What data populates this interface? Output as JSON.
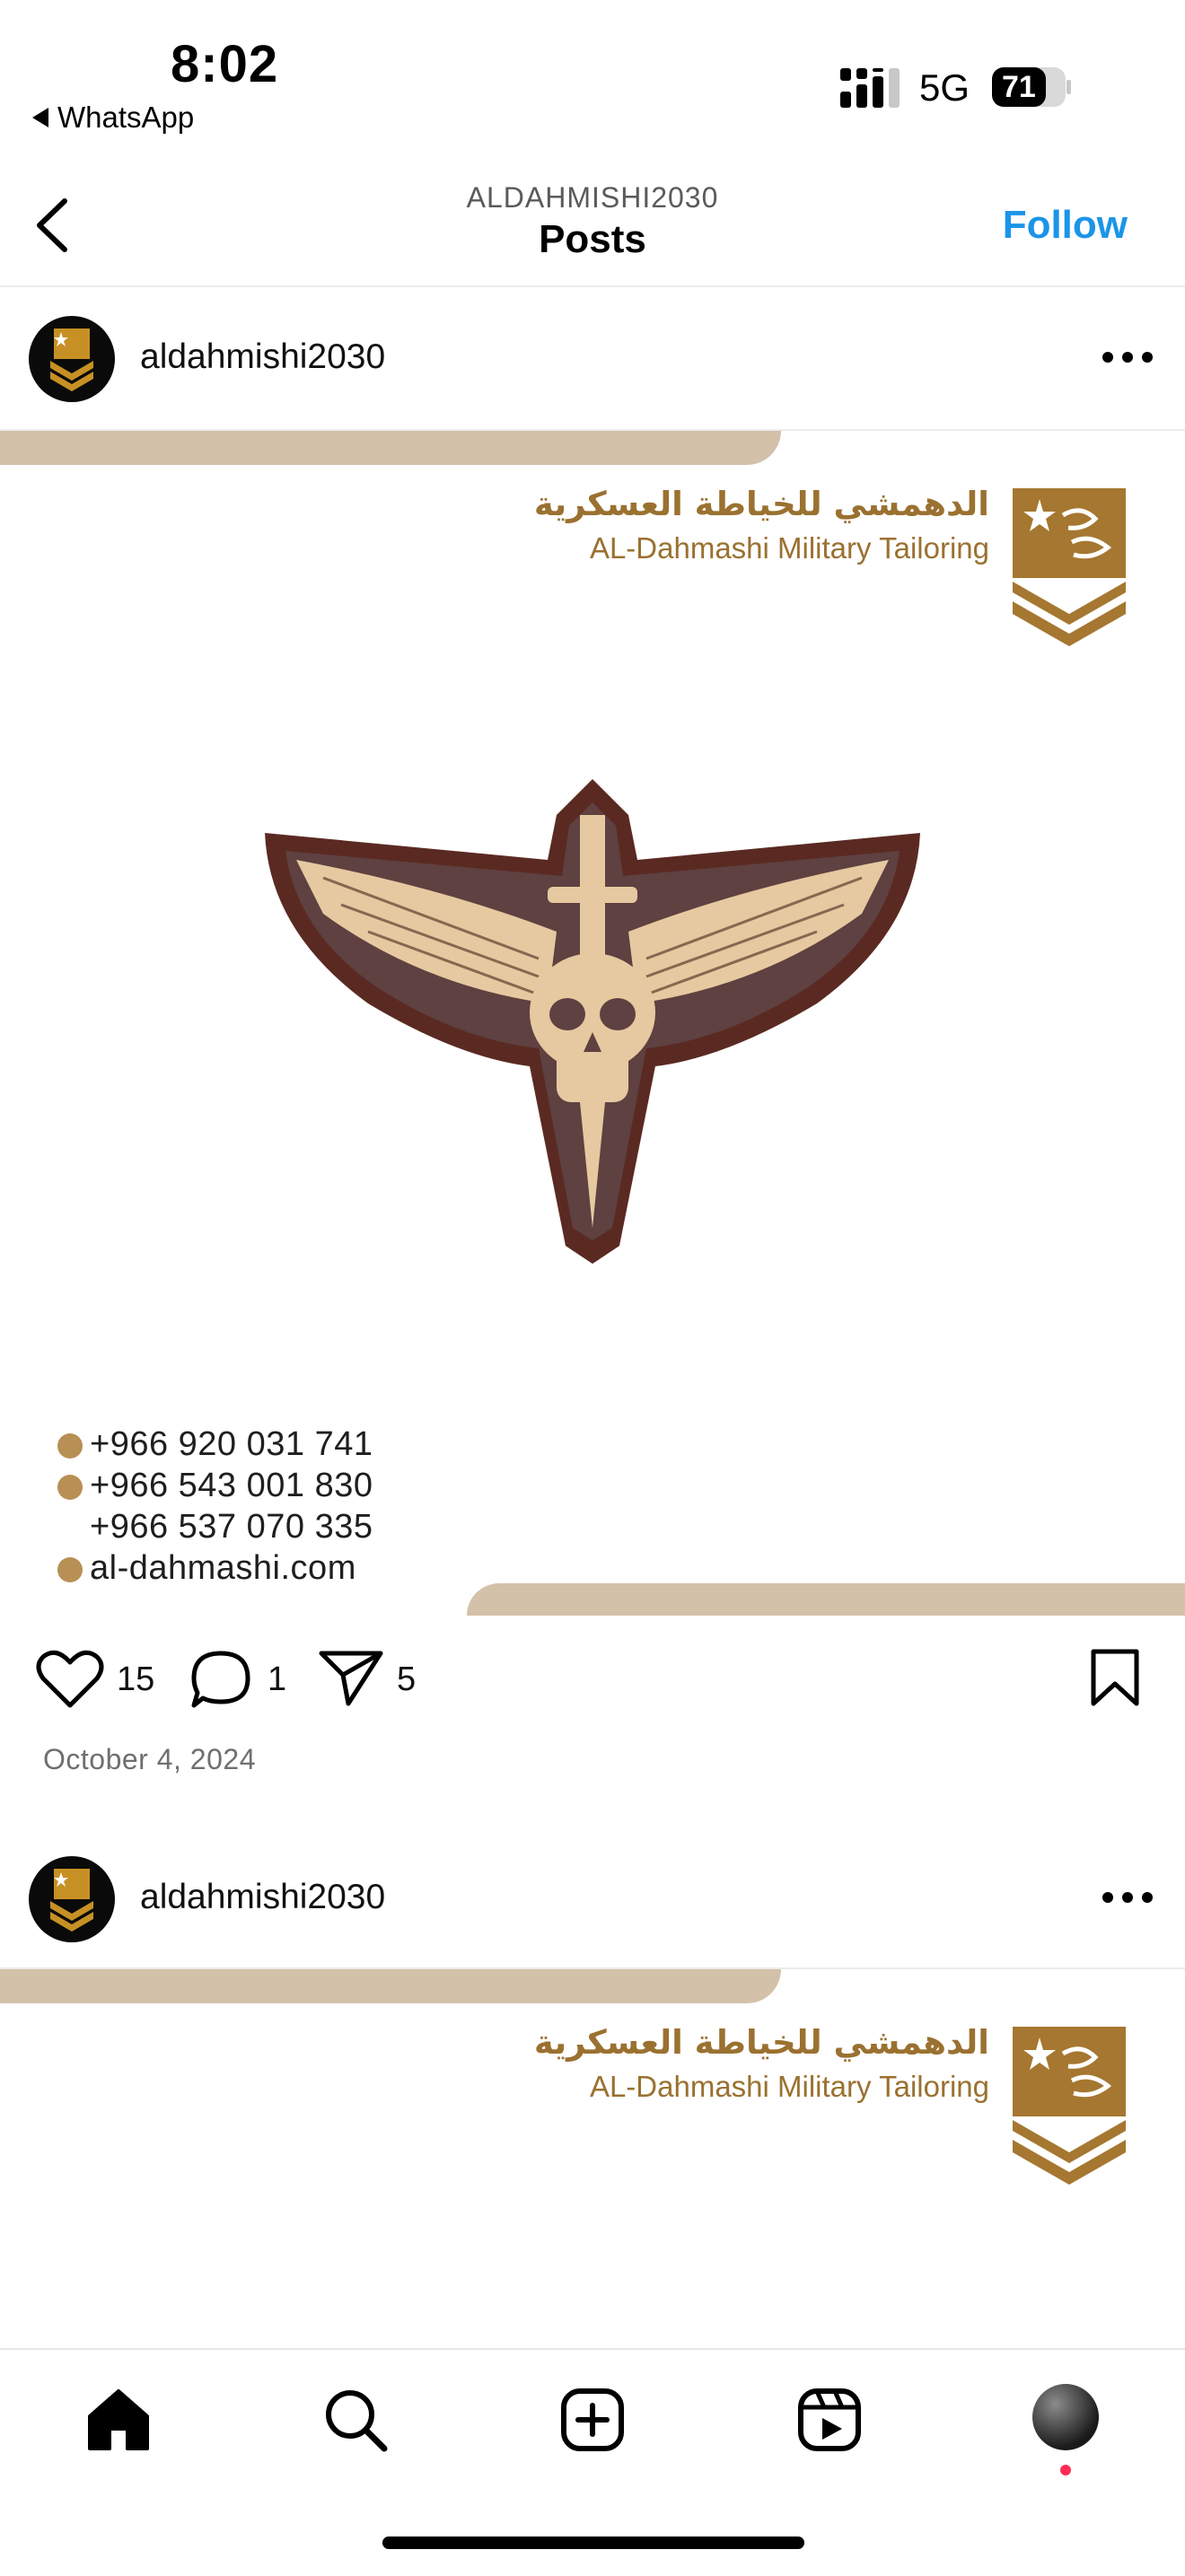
{
  "status_bar": {
    "time": "8:02",
    "back_app": "WhatsApp",
    "network": "5G",
    "battery": "71"
  },
  "header": {
    "subtitle": "ALDAHMISHI2030",
    "title": "Posts",
    "follow_label": "Follow"
  },
  "posts": [
    {
      "username": "aldahmishi2030",
      "image": {
        "brand_arabic": "الدهمشي للخياطة العسكرية",
        "brand_english": "AL-Dahmashi Military Tailoring",
        "contacts": [
          "+966 920 031 741",
          "+966 543 001 830",
          "+966 537 070 335"
        ],
        "website": "al-dahmashi.com"
      },
      "likes": "15",
      "comments": "1",
      "shares": "5",
      "date": "October 4, 2024"
    },
    {
      "username": "aldahmishi2030",
      "image": {
        "brand_arabic": "الدهمشي للخياطة العسكرية",
        "brand_english": "AL-Dahmashi Military Tailoring"
      }
    }
  ],
  "colors": {
    "accent": "#1b95e8",
    "brand_gold": "#9a7130",
    "band": "#d3c1a9",
    "notification_dot": "#ff2d55"
  },
  "icons": [
    "home-icon",
    "search-icon",
    "create-icon",
    "reels-icon",
    "profile-avatar"
  ]
}
